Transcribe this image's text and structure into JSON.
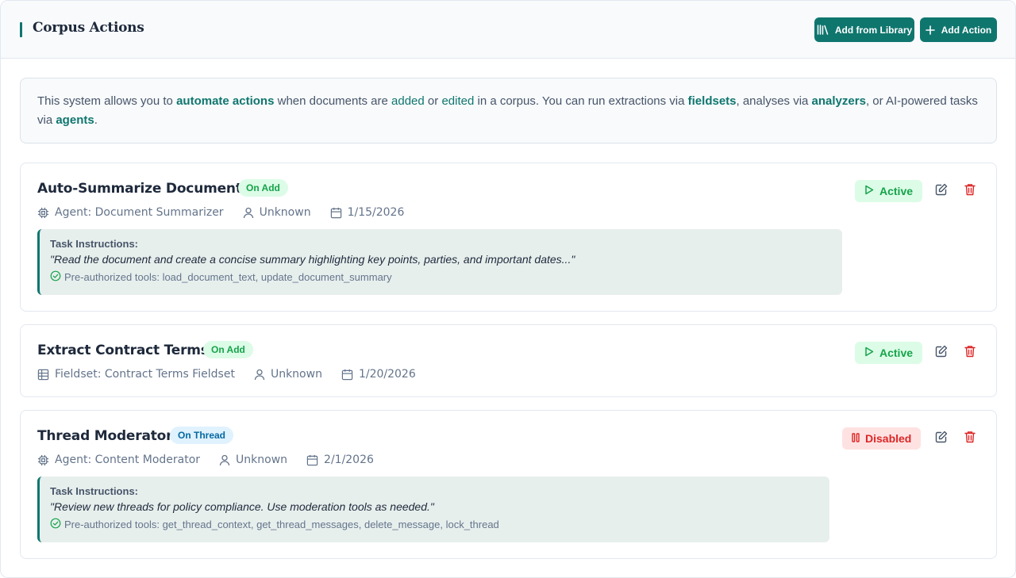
{
  "header": {
    "title": "Corpus Actions",
    "add_from_library_label": "Add from Library",
    "add_action_label": "Add Action"
  },
  "info": {
    "part1": "This system allows you to ",
    "automate_actions": "automate actions",
    "part2": " when documents are ",
    "added": "added",
    "part3": " or ",
    "edited": "edited",
    "part4": " in a corpus. You can run extractions via ",
    "fieldsets": "fieldsets",
    "part5": ", analyses via ",
    "analyzers": "analyzers",
    "part6": ", or AI-powered tasks via ",
    "agents": "agents",
    "part7": "."
  },
  "actions": [
    {
      "name": "Auto-Summarize Documents",
      "trigger": "On Add",
      "source_label": "Agent: Document Summarizer",
      "source_icon": "cpu-icon",
      "creator": "Unknown",
      "date": "1/15/2026",
      "task_label": "Task Instructions:",
      "task_text": "\"Read the document and create a concise summary highlighting key points, parties, and important dates...\"",
      "tools": "Pre-authorized tools: load_document_text, update_document_summary",
      "status": "Active"
    },
    {
      "name": "Extract Contract Terms",
      "trigger": "On Add",
      "source_label": "Fieldset: Contract Terms Fieldset",
      "source_icon": "table-icon",
      "creator": "Unknown",
      "date": "1/20/2026",
      "status": "Active"
    },
    {
      "name": "Thread Moderator",
      "trigger": "On Thread",
      "source_label": "Agent: Content Moderator",
      "source_icon": "cpu-icon",
      "creator": "Unknown",
      "date": "2/1/2026",
      "task_label": "Task Instructions:",
      "task_text": "\"Review new threads for policy compliance. Use moderation tools as needed.\"",
      "tools": "Pre-authorized tools: get_thread_context, get_thread_messages, delete_message, lock_thread",
      "status": "Disabled"
    }
  ],
  "colors": {
    "accent": "#0f766e",
    "active_bg": "#dcfce7",
    "active_text": "#16a34a",
    "disabled_bg": "#fee2e2",
    "disabled_text": "#dc2626",
    "thread_bg": "#e0f2fe",
    "thread_text": "#0369a1"
  }
}
